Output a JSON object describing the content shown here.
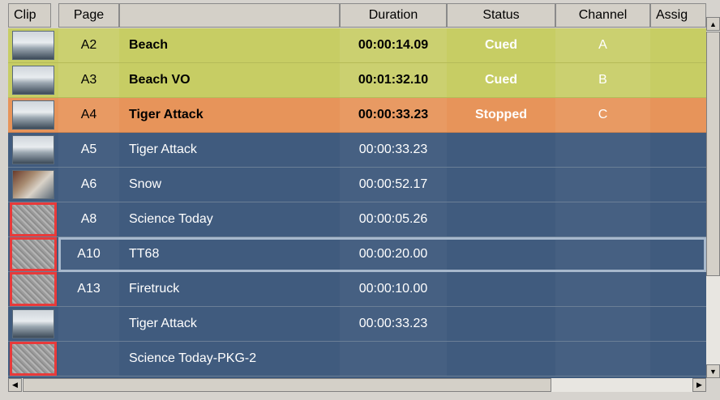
{
  "columns": {
    "clip": "Clip",
    "page": "Page",
    "name": "",
    "duration": "Duration",
    "status": "Status",
    "channel": "Channel",
    "assign": "Assig"
  },
  "rows": [
    {
      "thumb": "image",
      "page": "A2",
      "name": "Beach",
      "duration": "00:00:14.09",
      "status": "Cued",
      "channel": "A",
      "color": "yellow"
    },
    {
      "thumb": "image",
      "page": "A3",
      "name": "Beach VO",
      "duration": "00:01:32.10",
      "status": "Cued",
      "channel": "B",
      "color": "yellow"
    },
    {
      "thumb": "image",
      "page": "A4",
      "name": "Tiger Attack",
      "duration": "00:00:33.23",
      "status": "Stopped",
      "channel": "C",
      "color": "orange"
    },
    {
      "thumb": "image",
      "page": "A5",
      "name": "Tiger Attack",
      "duration": "00:00:33.23",
      "status": "",
      "channel": "",
      "color": "blue"
    },
    {
      "thumb": "snow",
      "page": "A6",
      "name": "Snow",
      "duration": "00:00:52.17",
      "status": "",
      "channel": "",
      "color": "blue"
    },
    {
      "thumb": "noise",
      "page": "A8",
      "name": "Science Today",
      "duration": "00:00:05.26",
      "status": "",
      "channel": "",
      "color": "blue"
    },
    {
      "thumb": "noise",
      "page": "A10",
      "name": "TT68",
      "duration": "00:00:20.00",
      "status": "",
      "channel": "",
      "color": "blue",
      "selected": true
    },
    {
      "thumb": "noise",
      "page": "A13",
      "name": "Firetruck",
      "duration": "00:00:10.00",
      "status": "",
      "channel": "",
      "color": "blue"
    },
    {
      "thumb": "image",
      "page": "",
      "name": "Tiger Attack",
      "duration": "00:00:33.23",
      "status": "",
      "channel": "",
      "color": "blue"
    },
    {
      "thumb": "noise",
      "page": "",
      "name": "Science Today-PKG-2",
      "duration": "",
      "status": "",
      "channel": "",
      "color": "blue"
    }
  ],
  "icons": {
    "scroll_up": "scroll-up-arrow-icon",
    "scroll_down": "scroll-down-arrow-icon",
    "scroll_left": "scroll-left-arrow-icon",
    "scroll_right": "scroll-right-arrow-icon"
  },
  "colors": {
    "cued_row": "#c7cd64",
    "stopped_row": "#e7945a",
    "idle_row": "#405b7e",
    "offline_clip_border": "#e83a3a"
  }
}
